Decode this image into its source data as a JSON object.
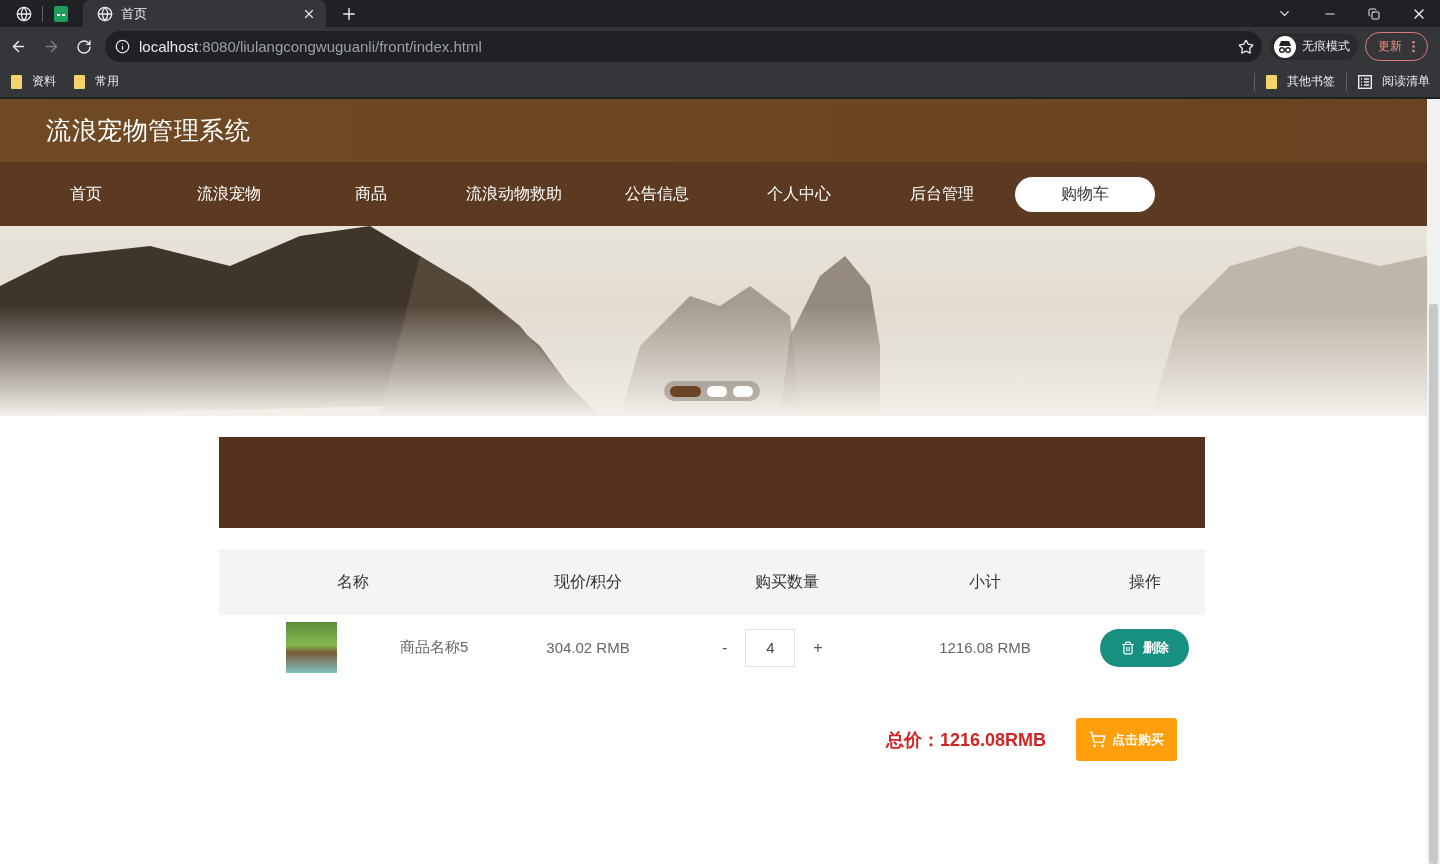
{
  "browser": {
    "tabs": [
      {
        "kind": "pinned",
        "selected": false
      },
      {
        "kind": "pinned",
        "selected": false
      },
      {
        "kind": "page",
        "title": "首页",
        "selected": true
      }
    ],
    "address": {
      "host": "localhost",
      "path": ":8080/liulangcongwuguanli/front/index.html"
    },
    "profile": "无痕模式",
    "update": "更新",
    "bookmarks": [
      "资料",
      "常用"
    ],
    "other_bookmarks": "其他书签",
    "reading_list": "阅读清单"
  },
  "site": {
    "title": "流浪宠物管理系统"
  },
  "nav": [
    {
      "label": "首页",
      "selected": false
    },
    {
      "label": "流浪宠物",
      "selected": false
    },
    {
      "label": "商品",
      "selected": false
    },
    {
      "label": "流浪动物救助",
      "selected": false
    },
    {
      "label": "公告信息",
      "selected": false
    },
    {
      "label": "个人中心",
      "selected": false
    },
    {
      "label": "后台管理",
      "selected": false
    },
    {
      "label": "购物车",
      "selected": true
    }
  ],
  "banner": {
    "slides": [
      {
        "selected": true
      },
      {
        "selected": false
      },
      {
        "selected": false
      }
    ]
  },
  "cart": {
    "columns": [
      "名称",
      "现价/积分",
      "购买数量",
      "小计",
      "操作"
    ],
    "rows": [
      {
        "name": "商品名称5",
        "price": "304.02 RMB",
        "decrement": "-",
        "quantity": "4",
        "increment": "+",
        "subtotal": "1216.08 RMB",
        "action": "删除"
      }
    ],
    "total": "总价：1216.08RMB",
    "buy": "点击购买"
  }
}
